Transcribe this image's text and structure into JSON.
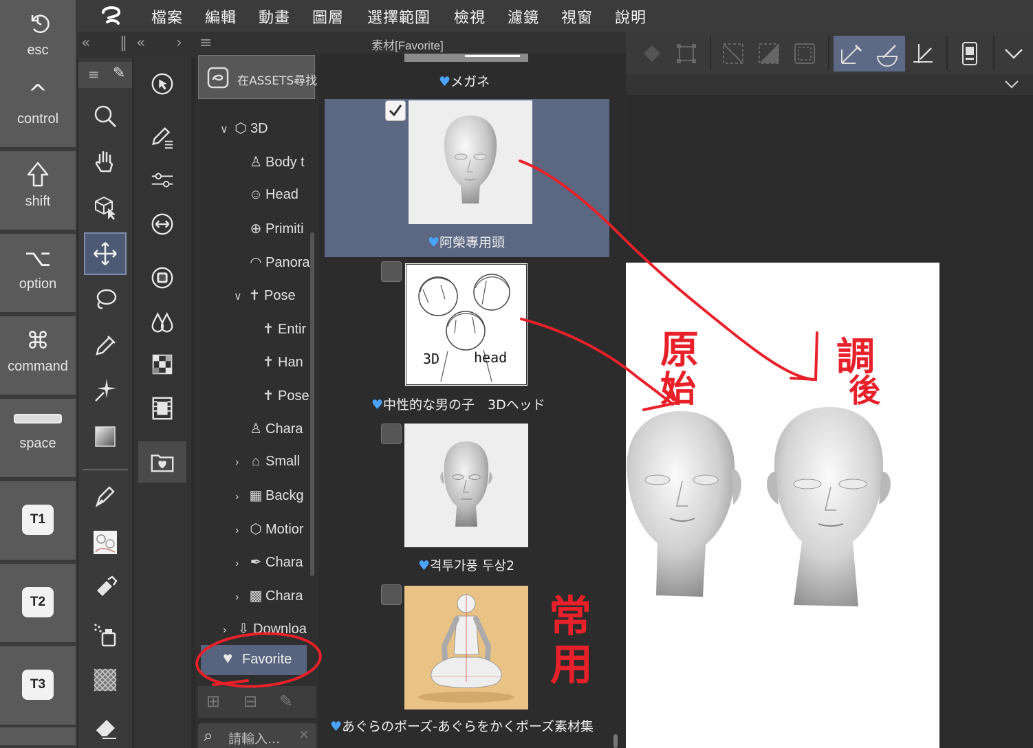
{
  "keys": {
    "esc": "esc",
    "control": "control",
    "shift": "shift",
    "option": "option",
    "command": "command",
    "space": "space",
    "t1": "T1",
    "t2": "T2",
    "t3": "T3"
  },
  "menu": [
    "檔案",
    "編輯",
    "動畫",
    "圖層",
    "選擇範圍",
    "檢視",
    "濾鏡",
    "視窗",
    "說明"
  ],
  "material_panel": {
    "title": "素材[Favorite]",
    "assets_button": "在ASSETS尋找",
    "tree": [
      {
        "label": "3D"
      },
      {
        "label": "Body t"
      },
      {
        "label": "Head"
      },
      {
        "label": "Primiti"
      },
      {
        "label": "Panora"
      },
      {
        "label": "Pose"
      },
      {
        "label": "Entir"
      },
      {
        "label": "Han"
      },
      {
        "label": "Pose"
      },
      {
        "label": "Chara"
      },
      {
        "label": "Small"
      },
      {
        "label": "Backg"
      },
      {
        "label": "Motior"
      },
      {
        "label": "Chara"
      },
      {
        "label": "Chara"
      },
      {
        "label": "Downloa"
      }
    ],
    "favorite": "Favorite",
    "search_placeholder": "請輸入...",
    "items": [
      {
        "label": "メガネ",
        "checked": false
      },
      {
        "label": "阿榮專用頭",
        "checked": true
      },
      {
        "label": "中性的な男の子　3Dヘッド",
        "checked": false
      },
      {
        "label": "격투가풍 두상2",
        "checked": false
      },
      {
        "label": "あぐらのポーズ-あぐらをかくポーズ素材集",
        "checked": false
      }
    ],
    "thumb_text": {
      "left": "3D",
      "right": "head"
    }
  },
  "annotations": {
    "original": "原始",
    "adjusted": "調後",
    "frequent": "常用"
  },
  "colors": {
    "accent_selected": "#5c6782",
    "heart": "#4aa3ff",
    "annotation_red": "#e8202a"
  }
}
